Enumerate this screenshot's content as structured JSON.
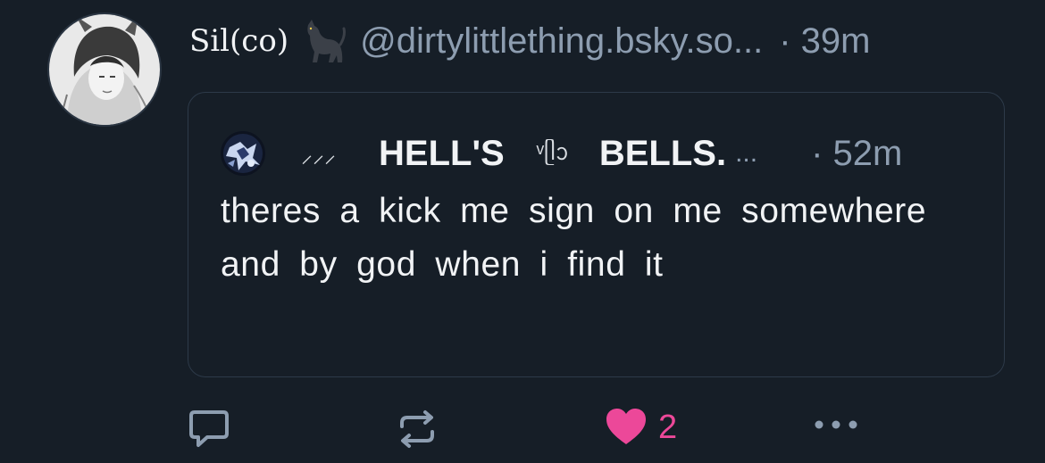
{
  "post": {
    "display_name": "Sil(co)",
    "handle": "@dirtylittlething.bsky.so...",
    "time": "· 39m"
  },
  "quote": {
    "deco1": "⸝⸝⸝",
    "name_part1": "HELL'S",
    "deco2": "ᵛᥫᩣ",
    "name_part2": "BELLS.",
    "ellipsis": "...",
    "time": "· 52m",
    "text": "theres a kick me sign on me somewhere and by god when i find it"
  },
  "actions": {
    "reply_icon": "reply-icon",
    "repost_icon": "repost-icon",
    "like_icon": "heart-icon",
    "like_count": "2",
    "more_icon": "more-icon"
  },
  "colors": {
    "background": "#161e27",
    "text": "#f1f3f5",
    "muted": "#8d9db0",
    "like": "#ec4899",
    "border": "#2d3a49"
  }
}
